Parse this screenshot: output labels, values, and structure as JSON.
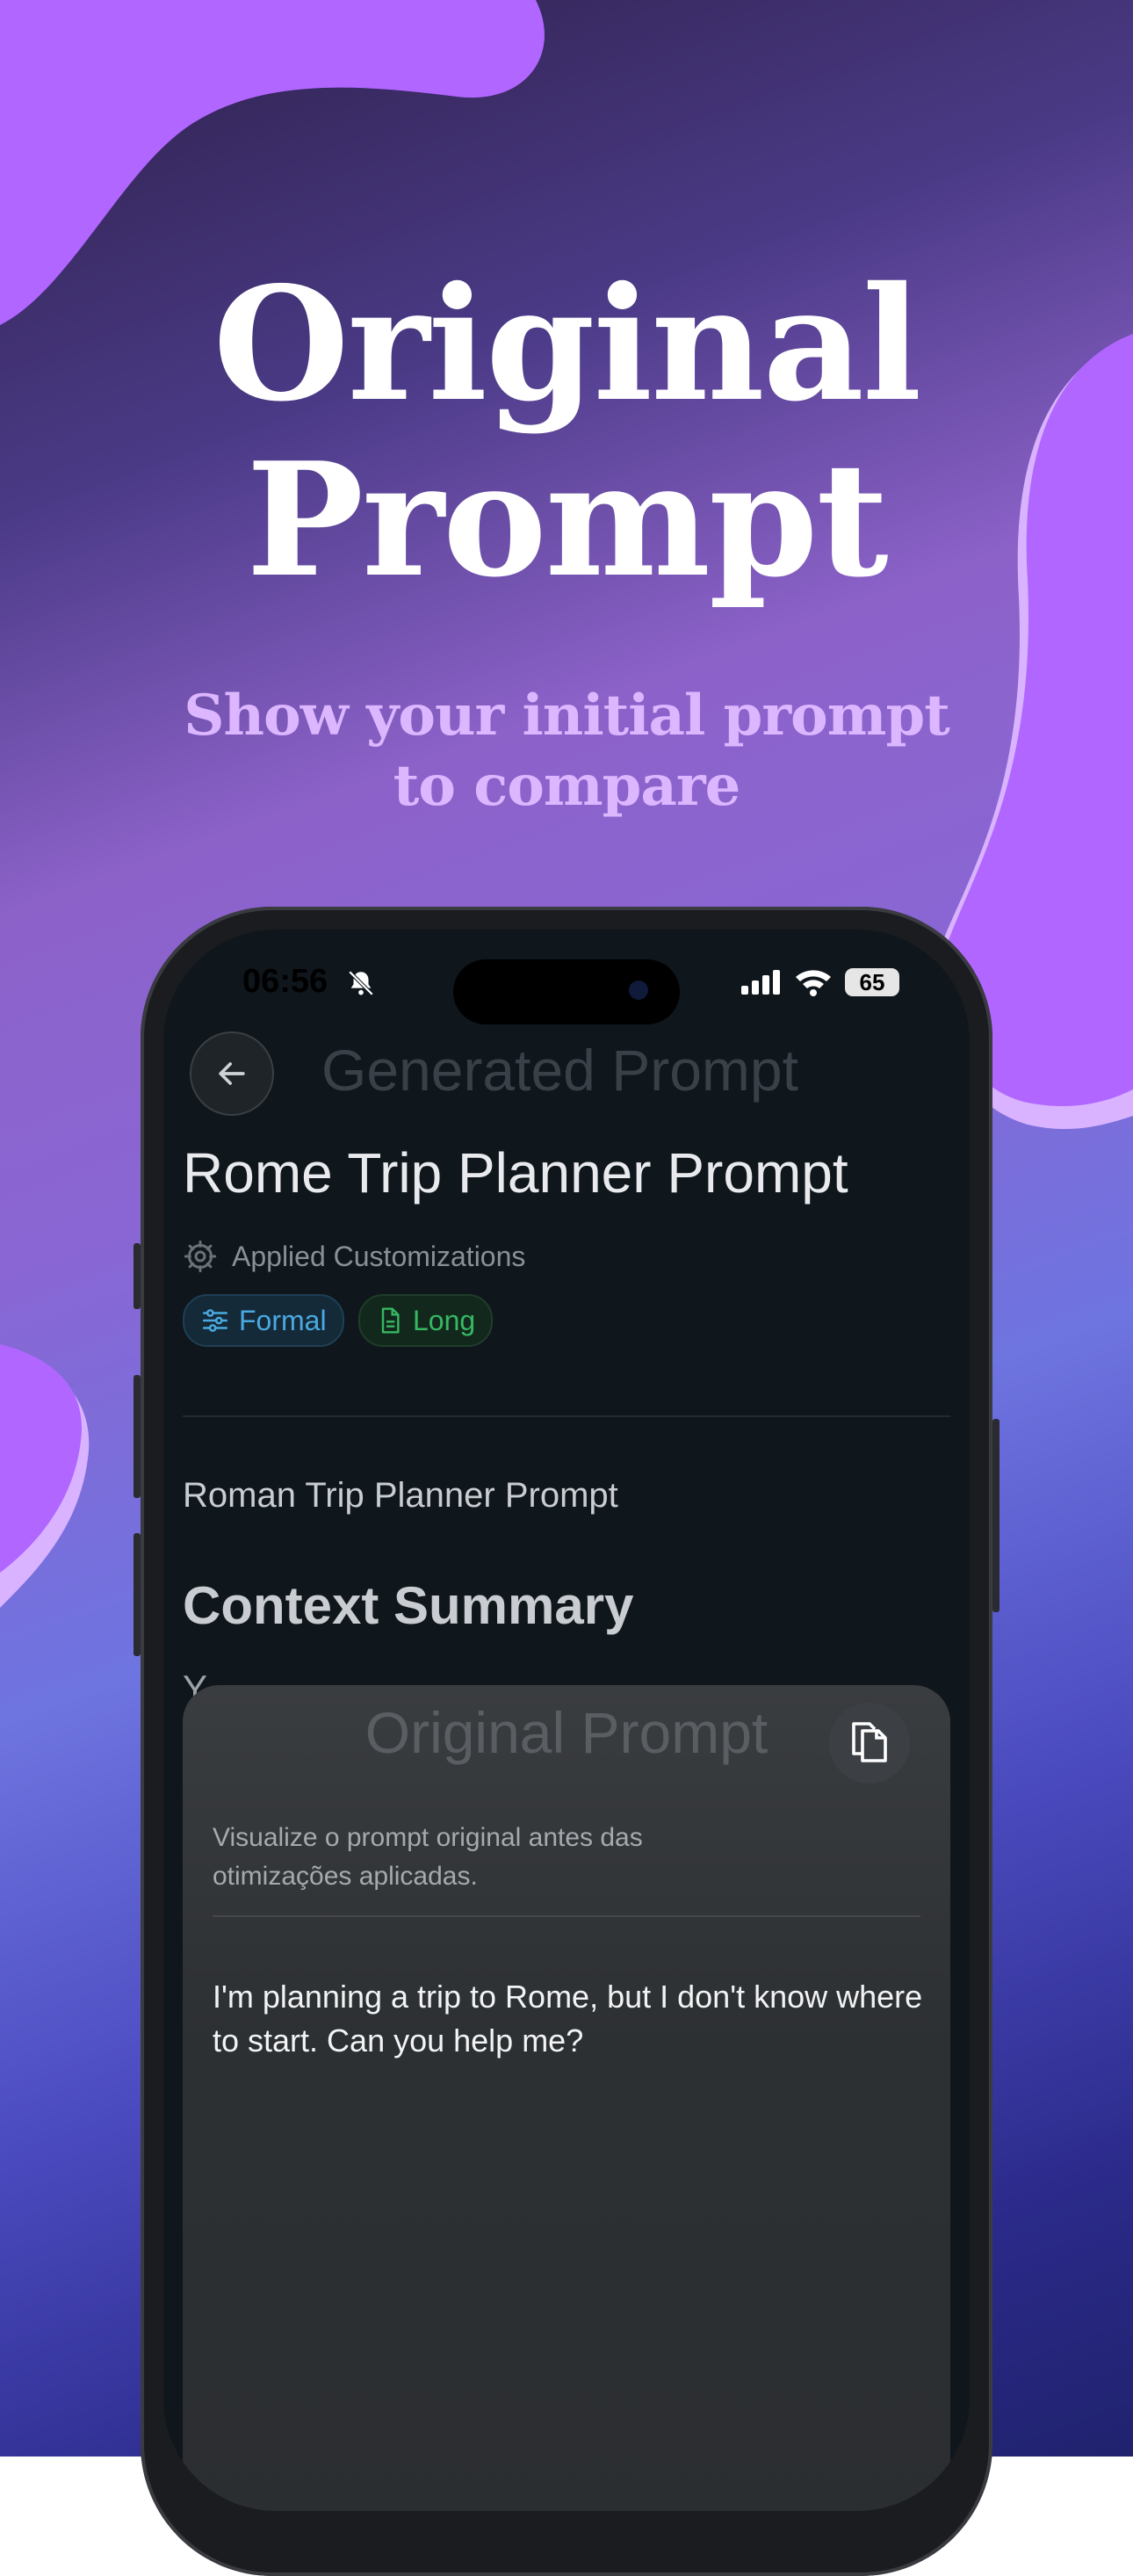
{
  "headline": {
    "line1": "Original",
    "line2": "Prompt"
  },
  "subheadline": "Show your initial prompt to compare",
  "status_bar": {
    "time": "06:56",
    "battery": "65"
  },
  "nav": {
    "title": "Generated Prompt"
  },
  "prompt_title": "Rome Trip Planner Prompt",
  "customizations": {
    "label": "Applied Customizations",
    "chips": [
      {
        "label": "Formal",
        "color": "#4aa9e0"
      },
      {
        "label": "Long",
        "color": "#36b862"
      }
    ]
  },
  "content": {
    "heading1": "Roman Trip Planner Prompt",
    "heading2": "Context Summary",
    "partial_char": "Y"
  },
  "sheet": {
    "title": "Original Prompt",
    "description": "Visualize o prompt original antes das otimizações aplicadas.",
    "prompt_text": "I'm planning a trip to Rome, but I don't know where to start. Can you help me?"
  }
}
